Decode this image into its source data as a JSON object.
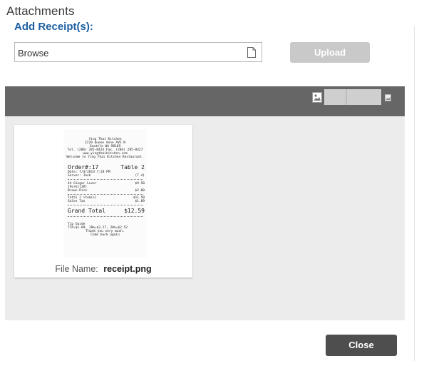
{
  "header": {
    "title": "Attachments",
    "subtitle": "Add Receipt(s):"
  },
  "upload_row": {
    "browse_label": "Browse",
    "upload_label": "Upload"
  },
  "viewer": {
    "toolbar_icons": [
      "image-icon",
      "zoom-slider",
      "image-small-icon"
    ]
  },
  "attachment": {
    "file_name_label": "File Name:",
    "file_name": "receipt.png",
    "receipt": {
      "restaurant": "Ying Thai Kitchen",
      "address_1": "2220 Queen Anne AVE N",
      "address_2": "Seattle WA 98109",
      "phone": "Tel. (206) 285-8424 Fax. (206) 285-8427",
      "website": "www.yingthaikitchen.com",
      "welcome": "Welcome to Ying Thai Kitchen Restaurant.",
      "order": "Order#:17",
      "table": "Table 2",
      "date": "Date: 7/4/2013 7:28 PM",
      "server": "Server: Jack",
      "guests": "(T.4)",
      "item_1_name": "44 Ginger Lover",
      "item_1_price": "$9.50",
      "item_1_note": "[Pork][2#]",
      "item_2_name": "Brown Rice",
      "item_2_price": "$2.00",
      "total_items_label": "Total 2 item(s)",
      "total_items_value": "$11.50",
      "sales_tax_label": "Sales Tax",
      "sales_tax_value": "$1.09",
      "grand_total_label": "Grand Total",
      "grand_total_value": "$12.59",
      "tip_guide": "Tip Guide",
      "tip_line": "TIP=$1.89, 18%=$2.27, 20%=$2.52",
      "thanks": "Thank you very much.",
      "come_back": "Come back again"
    }
  },
  "footer": {
    "close_label": "Close"
  }
}
